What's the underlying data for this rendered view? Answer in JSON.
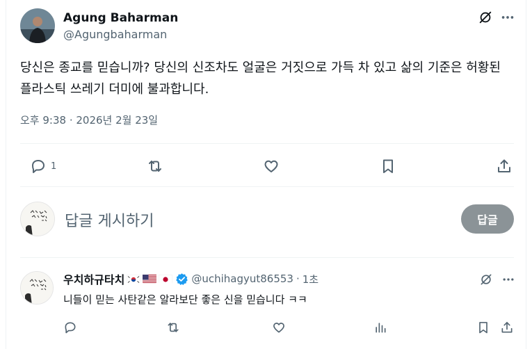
{
  "post": {
    "author_name": "Agung Baharman",
    "author_handle": "@Agungbaharman",
    "text": "당신은 종교를 믿습니까? 당신의 신조차도 얼굴은 거짓으로 가득 차 있고 삶의 기준은 허황된 플라스틱 쓰레기 더미에 불과합니다.",
    "timestamp": "오후 9:38 · 2026년 2월 23일",
    "actions": {
      "reply_icon": "reply-icon",
      "reply_count": "1",
      "repost_icon": "repost-icon",
      "like_icon": "heart-icon",
      "bookmark_icon": "bookmark-icon",
      "share_icon": "share-icon"
    }
  },
  "composer": {
    "placeholder": "답글 게시하기",
    "button_label": "답글"
  },
  "reply": {
    "name": "우치하규타치",
    "flags": [
      "south-korea-flag",
      "usa-flag",
      "japan-flag"
    ],
    "verified_icon": "verified-badge-icon",
    "handle": "@uchihagyut86553",
    "separator": "·",
    "time": "1초",
    "text": "니들이 믿는 사탄같은 알라보단 좋은 신을 믿습니다 ㅋㅋ"
  },
  "colors": {
    "text_primary": "#0f1419",
    "text_secondary": "#536471",
    "divider": "#eff3f4",
    "reply_button_bg": "#8b9397",
    "verified_blue": "#1d9bf0"
  }
}
